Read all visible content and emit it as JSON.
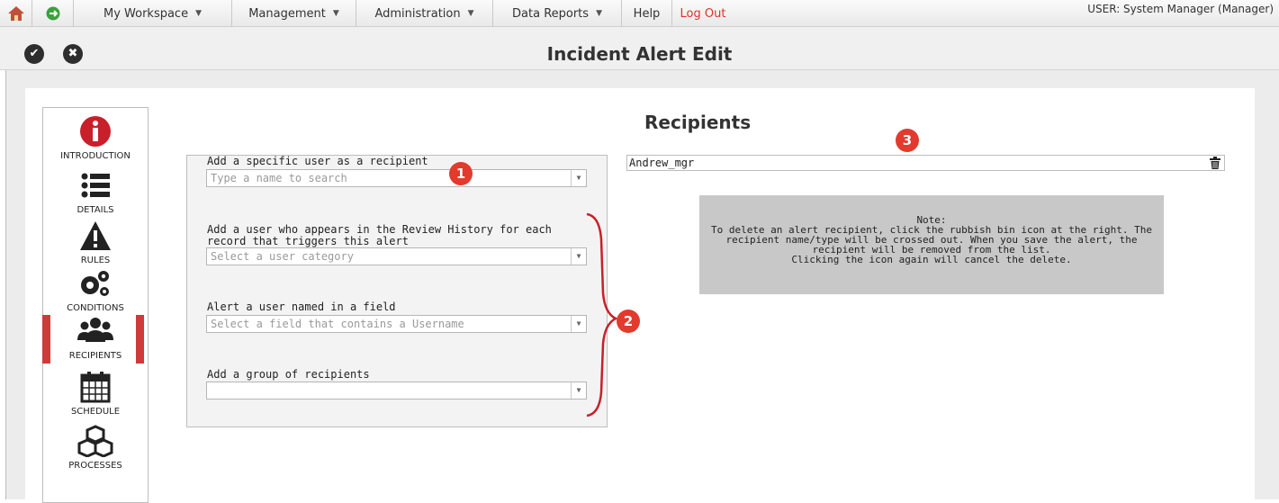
{
  "menubar": {
    "items": [
      {
        "label": "My Workspace",
        "caret": true
      },
      {
        "label": "Management",
        "caret": true
      },
      {
        "label": "Administration",
        "caret": true
      },
      {
        "label": "Data Reports",
        "caret": true
      },
      {
        "label": "Help",
        "caret": false
      },
      {
        "label": "Log Out",
        "caret": false
      }
    ],
    "user": "USER: System Manager (Manager)"
  },
  "titlebar": {
    "title": "Incident Alert Edit",
    "save_glyph": "✔",
    "cancel_glyph": "✖"
  },
  "sidenav": {
    "items": [
      {
        "label": "INTRODUCTION",
        "icon": "info-icon"
      },
      {
        "label": "DETAILS",
        "icon": "list-icon"
      },
      {
        "label": "RULES",
        "icon": "warning-icon"
      },
      {
        "label": "CONDITIONS",
        "icon": "gears-icon"
      },
      {
        "label": "RECIPIENTS",
        "icon": "group-icon",
        "active": true
      },
      {
        "label": "SCHEDULE",
        "icon": "calendar-icon"
      },
      {
        "label": "PROCESSES",
        "icon": "cubes-icon"
      }
    ]
  },
  "main": {
    "heading": "Recipients",
    "form": {
      "specific_user_label": "Add a specific user as a recipient",
      "specific_user_placeholder": "Type a name to search",
      "review_history_label": "Add a user who appears in the Review History for each record that triggers this alert",
      "review_history_placeholder": "Select a user category",
      "field_user_label": "Alert a user named in a field",
      "field_user_placeholder": "Select a field that contains a Username",
      "group_label": "Add a group of recipients",
      "group_value": ""
    },
    "recipients": [
      {
        "name": "Andrew_mgr"
      }
    ],
    "note": {
      "line1": "Note:",
      "line2": "To delete an alert recipient, click the rubbish bin icon at the right. The",
      "line3": "recipient name/type will be crossed out. When you save the alert, the",
      "line4": "recipient will be removed from the list.",
      "line5": "Clicking the icon again will cancel the delete."
    }
  },
  "annotations": {
    "badge1": "1",
    "badge2": "2",
    "badge3": "3"
  },
  "colors": {
    "accent_red": "#e23a2c",
    "active_bar": "#cf3a3a",
    "logout": "#e0322b"
  }
}
